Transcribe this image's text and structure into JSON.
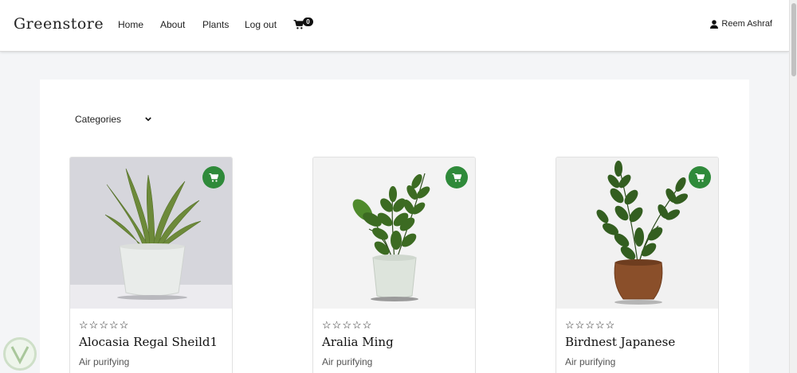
{
  "nav": {
    "brand": "Greenstore",
    "links": [
      "Home",
      "About",
      "Plants",
      "Log out"
    ],
    "cart_count": "0",
    "user_name": "Reem Ashraf"
  },
  "filter": {
    "label": "Categories"
  },
  "products": [
    {
      "name": "Alocasia Regal Sheild1",
      "tag": "Air purifying",
      "rating": 0
    },
    {
      "name": "Aralia Ming",
      "tag": "Air purifying",
      "rating": 0
    },
    {
      "name": "Birdnest Japanese",
      "tag": "Air purifying",
      "rating": 0
    }
  ],
  "icons": {
    "cart": "cart-icon",
    "user": "user-icon",
    "chevron": "chevron-down-icon",
    "star": "star-outline-icon"
  },
  "colors": {
    "accent": "#2f8a3a",
    "page_bg": "#f4f5f7"
  }
}
